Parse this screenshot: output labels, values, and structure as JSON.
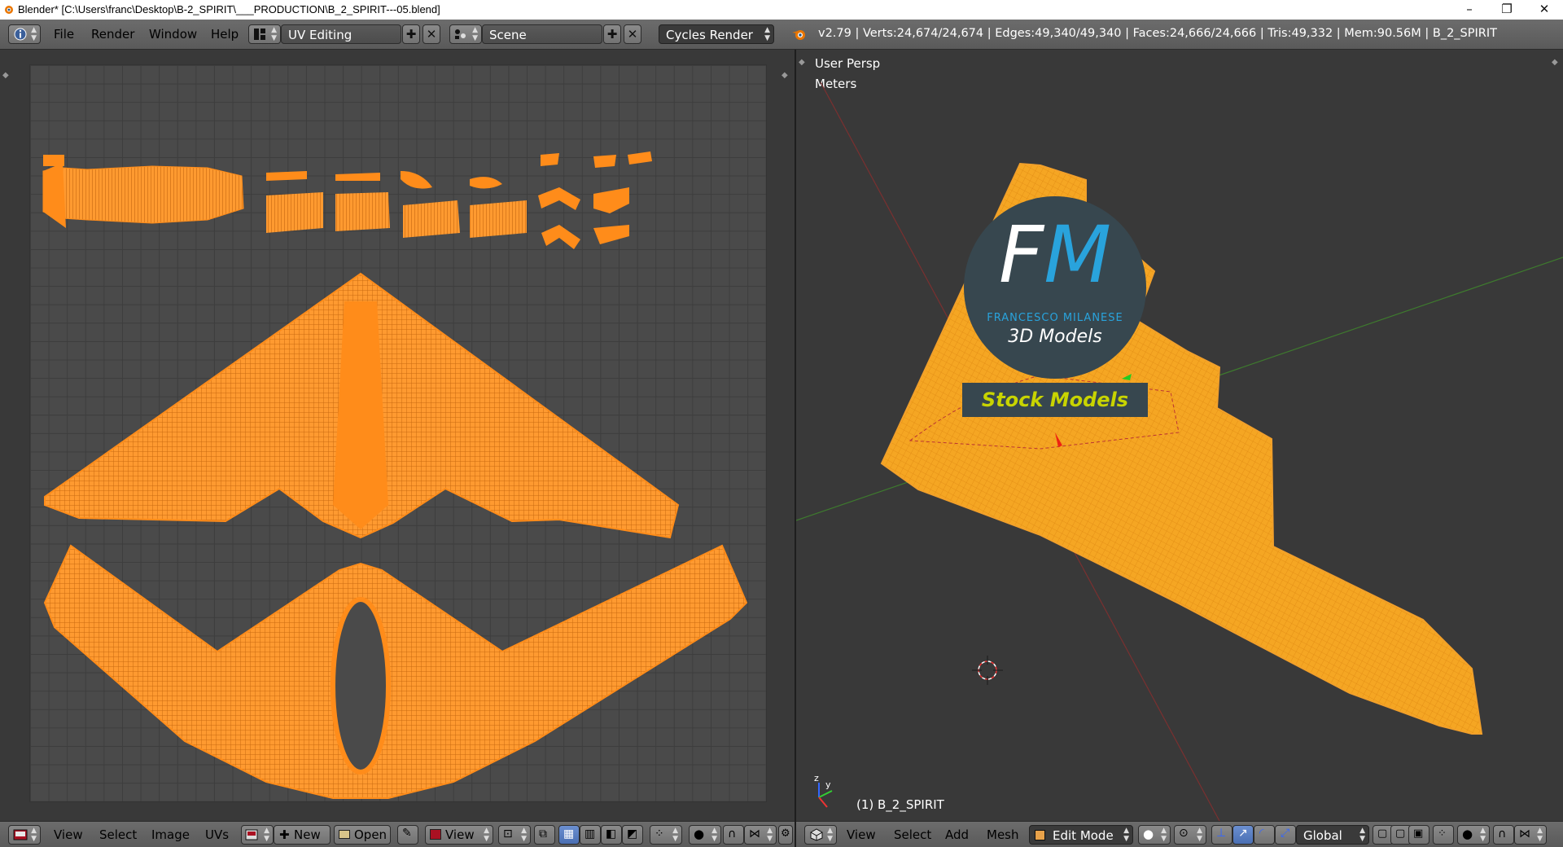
{
  "window": {
    "title": "Blender* [C:\\Users\\franc\\Desktop\\B-2_SPIRIT\\___PRODUCTION\\B_2_SPIRIT---05.blend]",
    "controls": [
      "–",
      "❐",
      "✕"
    ]
  },
  "top_header": {
    "menus": [
      "File",
      "Render",
      "Window",
      "Help"
    ],
    "screen_layout": "UV Editing",
    "scene": "Scene",
    "render_engine": "Cycles Render",
    "stats": "v2.79 | Verts:24,674/24,674 | Edges:49,340/49,340 | Faces:24,666/24,666 | Tris:49,332 | Mem:90.56M | B_2_SPIRIT"
  },
  "uv_editor": {
    "menus": [
      "View",
      "Select",
      "Image",
      "UVs"
    ],
    "new_label": "New",
    "open_label": "Open",
    "view_label": "View",
    "wire_color": "#ff8c1a"
  },
  "viewport": {
    "view_name": "User Persp",
    "units": "Meters",
    "object_label": "(1) B_2_SPIRIT",
    "menus": [
      "View",
      "Select",
      "Add",
      "Mesh"
    ],
    "mode": "Edit Mode",
    "orientation": "Global",
    "mesh_color": "#f5a623"
  },
  "watermark": {
    "logo": "FM",
    "author": "FRANCESCO MILANESE",
    "tagline": "3D Models",
    "banner": "Stock Models",
    "accent": "#29a3dc",
    "banner_color": "#c8d400"
  }
}
